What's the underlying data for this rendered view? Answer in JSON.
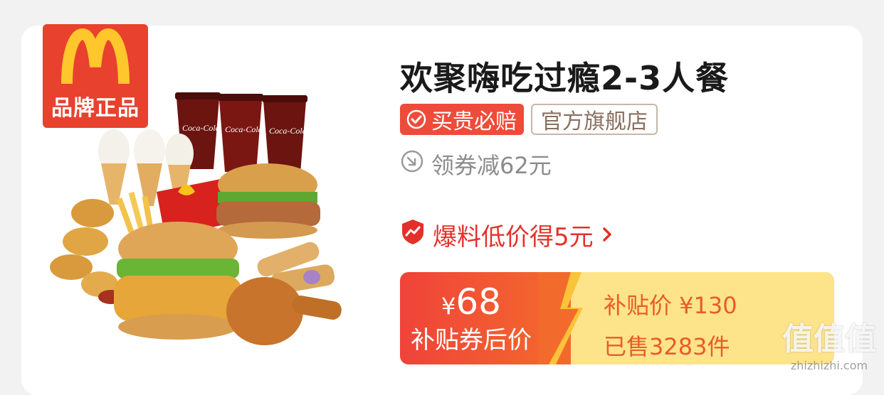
{
  "brand_badge": {
    "label": "品牌正品",
    "logo": "mcdonalds-arches-logo"
  },
  "product": {
    "title": "欢聚嗨吃过瘾2-3人餐",
    "image": "mcdonalds-meal-set-image"
  },
  "tags": {
    "guarantee": "买贵必赔",
    "store": "官方旗舰店"
  },
  "coupon": {
    "text": "领券减62元",
    "icon": "arrow-circle-icon"
  },
  "deal": {
    "text": "爆料低价得5元",
    "icon": "trend-shield-icon",
    "chevron": "chevron-right-icon"
  },
  "price": {
    "currency": "¥",
    "amount": "68",
    "amount_label": "补贴券后价",
    "subsidy_price": "补贴价 ¥130",
    "sold": "已售3283件"
  },
  "watermark": {
    "logo": "值值值",
    "url": "zhizhizhi.com"
  },
  "colors": {
    "accent_red": "#ef4b3a",
    "badge_red": "#e8412e",
    "price_yellow": "#fde48a",
    "store_border": "#c9b6a9"
  }
}
